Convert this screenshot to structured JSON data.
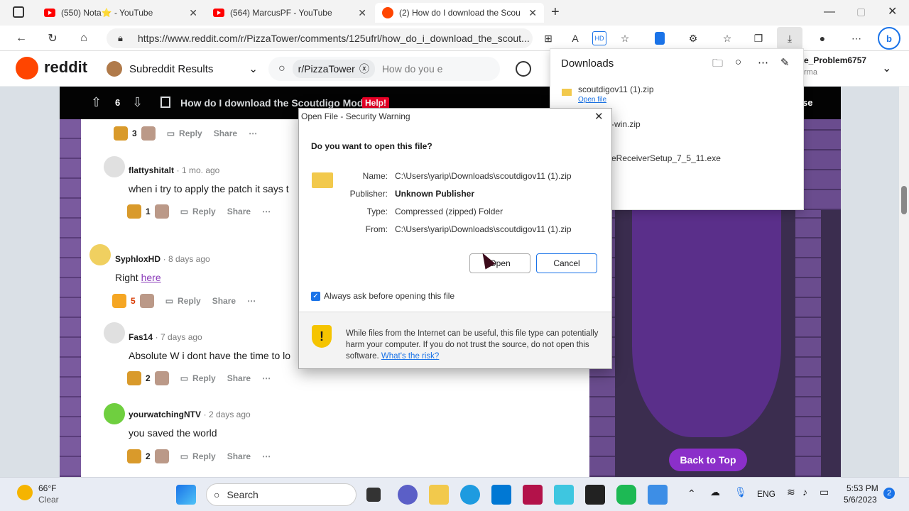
{
  "browser": {
    "tabs": [
      {
        "title": "(550) Nota⭐ - YouTube"
      },
      {
        "title": "(564) MarcusPF - YouTube"
      },
      {
        "title": "(2) How do I download the Scout"
      }
    ],
    "new_tab": "+",
    "url": "https://www.reddit.com/r/PizzaTower/comments/125ufrl/how_do_i_download_the_scout..."
  },
  "reddit": {
    "logo": "reddit",
    "subreddit_results": "Subreddit Results",
    "search_chip": "r/PizzaTower",
    "search_placeholder": "How do you e",
    "user": "e_Problem6757",
    "user_sub": "rma"
  },
  "post": {
    "votes": "6",
    "title": "How do I download the Scoutdigo Mod?",
    "flair": "Help!",
    "close": "se"
  },
  "comments": [
    {
      "votes": "3",
      "reply": "Reply",
      "share": "Share"
    },
    {
      "user": "flattyshitalt",
      "ago": "1 mo. ago",
      "text": "when i try to apply the patch it says t",
      "votes": "1",
      "reply": "Reply",
      "share": "Share"
    },
    {
      "user": "SyphloxHD",
      "ago": "8 days ago",
      "text_prefix": "Right ",
      "link": "here",
      "votes": "5",
      "reply": "Reply",
      "share": "Share"
    },
    {
      "user": "Fas14",
      "ago": "7 days ago",
      "text": "Absolute W i dont have the time to lo",
      "votes": "2",
      "reply": "Reply",
      "share": "Share"
    },
    {
      "user": "yourwatchingNTV",
      "ago": "2 days ago",
      "text": "you saved the world",
      "votes": "2",
      "reply": "Reply",
      "share": "Share"
    }
  ],
  "back_to_top": "Back to Top",
  "downloads": {
    "title": "Downloads",
    "items": [
      {
        "name": "scoutdigov11 (1).zip",
        "action": "Open file"
      },
      {
        "name": "-win.zip"
      },
      {
        "name": "eReceiverSetup_7_5_11.exe"
      }
    ]
  },
  "dialog": {
    "title": "Open File - Security Warning",
    "question": "Do you want to open this file?",
    "name_label": "Name:",
    "name": "C:\\Users\\yarip\\Downloads\\scoutdigov11 (1).zip",
    "publisher_label": "Publisher:",
    "publisher": "Unknown Publisher",
    "type_label": "Type:",
    "type": "Compressed (zipped) Folder",
    "from_label": "From:",
    "from": "C:\\Users\\yarip\\Downloads\\scoutdigov11 (1).zip",
    "open": "Open",
    "cancel": "Cancel",
    "checkbox": "Always ask before opening this file",
    "warning": "While files from the Internet can be useful, this file type can potentially harm your computer. If you do not trust the source, do not open this software.",
    "risk_link": "What's the risk?"
  },
  "taskbar": {
    "temp": "66°F",
    "weather": "Clear",
    "search": "Search",
    "lang": "ENG",
    "time": "5:53 PM",
    "date": "5/6/2023",
    "badge": "2"
  }
}
